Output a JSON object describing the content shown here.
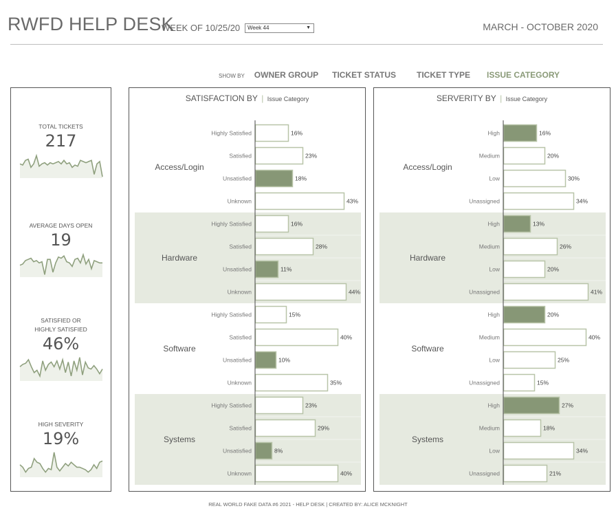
{
  "header": {
    "title": "RWFD HELP DESK",
    "week_of": "WEEK OF 10/25/20",
    "week_select": "Week 44",
    "date_range": "MARCH - OCTOBER 2020"
  },
  "show_by": {
    "label": "SHOW BY",
    "options": [
      {
        "label": "OWNER GROUP",
        "active": false
      },
      {
        "label": "TICKET STATUS",
        "active": false
      },
      {
        "label": "TICKET TYPE",
        "active": false
      },
      {
        "label": "ISSUE CATEGORY",
        "active": true
      }
    ]
  },
  "colors": {
    "accent": "#8a9a78",
    "highlight_bar": "#879776",
    "bar_outline": "#b8c4a8",
    "band": "#e6eae0",
    "sparkline": "#8fa07e",
    "sparkline_fill": "#eef1ea"
  },
  "kpis": [
    {
      "label_lines": [
        "TOTAL TICKETS"
      ],
      "value": "217",
      "spark": [
        0.55,
        0.5,
        0.7,
        0.75,
        0.4,
        0.55,
        0.9,
        0.45,
        0.55,
        0.6,
        0.5,
        0.6,
        0.55,
        0.6,
        0.65,
        0.55,
        0.7,
        0.55,
        0.6,
        0.4,
        0.5,
        0.45,
        0.7,
        0.65,
        0.6,
        0.65,
        0.7,
        0.1,
        0.55,
        0.65,
        0.0
      ]
    },
    {
      "label_lines": [
        "AVERAGE DAYS OPEN"
      ],
      "value": "19",
      "spark": [
        0.45,
        0.5,
        0.65,
        0.7,
        0.75,
        0.6,
        0.65,
        0.55,
        0.6,
        0.05,
        0.7,
        0.7,
        0.15,
        0.55,
        0.8,
        0.75,
        0.85,
        0.6,
        0.55,
        0.4,
        0.7,
        0.75,
        0.55,
        0.9,
        0.5,
        0.7,
        0.3,
        0.65,
        0.6,
        0.55,
        0.55
      ]
    },
    {
      "label_lines": [
        "SATISFIED OR",
        "HIGHLY SATISFIED"
      ],
      "value": "46%",
      "spark": [
        0.55,
        0.65,
        0.7,
        0.85,
        0.55,
        0.3,
        0.4,
        0.15,
        0.8,
        0.4,
        0.65,
        0.75,
        0.55,
        0.8,
        0.45,
        0.85,
        0.3,
        0.75,
        0.15,
        0.8,
        0.4,
        0.95,
        0.2,
        0.75,
        0.5,
        0.45,
        0.6,
        0.45,
        0.25,
        0.45
      ]
    },
    {
      "label_lines": [
        "HIGH SEVERITY"
      ],
      "value": "19%",
      "spark": [
        0.45,
        0.35,
        0.15,
        0.3,
        0.35,
        0.7,
        0.55,
        0.5,
        0.3,
        0.15,
        0.3,
        0.25,
        0.95,
        0.35,
        0.2,
        0.35,
        0.5,
        0.4,
        0.55,
        0.45,
        0.35,
        0.35,
        0.3,
        0.25,
        0.15,
        0.25,
        0.45,
        0.3,
        0.55,
        0.6
      ]
    }
  ],
  "chart_data": [
    {
      "type": "bar",
      "title": "SATISFACTION BY",
      "subtitle": "Issue Category",
      "xlim": [
        0,
        50
      ],
      "groups": [
        "Access/Login",
        "Hardware",
        "Software",
        "Systems"
      ],
      "categories": [
        "Highly Satisfied",
        "Satisfied",
        "Unsatisfied",
        "Unknown"
      ],
      "highlight": "Unsatisfied",
      "values": [
        [
          16,
          23,
          18,
          43
        ],
        [
          16,
          28,
          11,
          44
        ],
        [
          15,
          40,
          10,
          35
        ],
        [
          23,
          29,
          8,
          40
        ]
      ],
      "labels": [
        [
          "16%",
          "23%",
          "18%",
          "43%"
        ],
        [
          "16%",
          "28%",
          "11%",
          "44%"
        ],
        [
          "15%",
          "40%",
          "10%",
          "35%"
        ],
        [
          "23%",
          "29%",
          "8%",
          "40%"
        ]
      ]
    },
    {
      "type": "bar",
      "title": "SERVERITY BY",
      "subtitle": "Issue Category",
      "xlim": [
        0,
        50
      ],
      "groups": [
        "Access/Login",
        "Hardware",
        "Software",
        "Systems"
      ],
      "categories": [
        "High",
        "Medium",
        "Low",
        "Unassigned"
      ],
      "highlight": "High",
      "values": [
        [
          16,
          20,
          30,
          34
        ],
        [
          13,
          26,
          20,
          41
        ],
        [
          20,
          40,
          25,
          15
        ],
        [
          27,
          18,
          34,
          21
        ]
      ],
      "labels": [
        [
          "16%",
          "20%",
          "30%",
          "34%"
        ],
        [
          "13%",
          "26%",
          "20%",
          "41%"
        ],
        [
          "20%",
          "40%",
          "25%",
          "15%"
        ],
        [
          "27%",
          "18%",
          "34%",
          "21%"
        ]
      ]
    }
  ],
  "footer": "REAL WORLD FAKE DATA #6 2021 - HELP DESK | CREATED BY: ALICE MCKNIGHT"
}
